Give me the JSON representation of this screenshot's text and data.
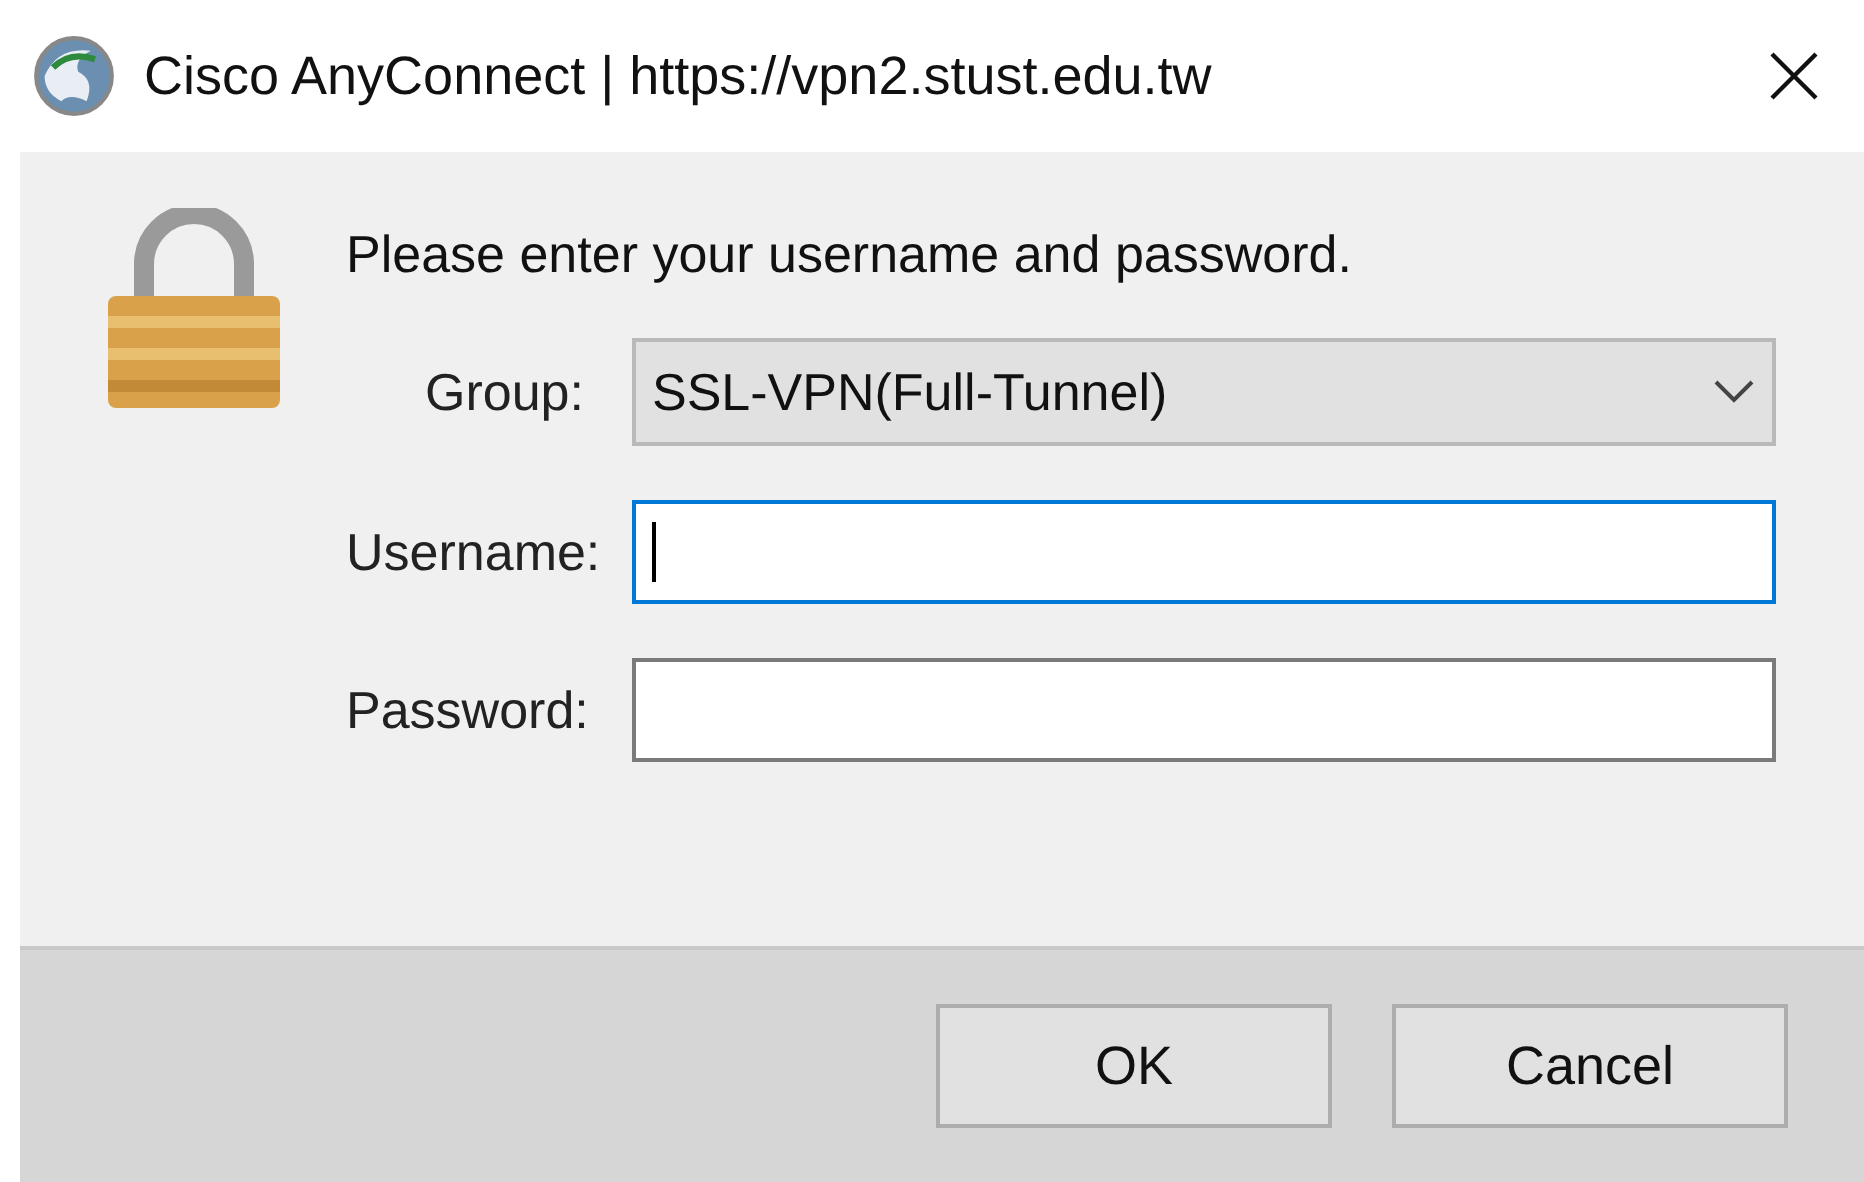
{
  "window": {
    "title": "Cisco AnyConnect | https://vpn2.stust.edu.tw"
  },
  "message": "Please enter your username and password.",
  "fields": [
    {
      "kind": "dropdown",
      "label": "Group:",
      "value": "SSL-VPN(Full-Tunnel)",
      "focused": false
    },
    {
      "kind": "text",
      "label": "Username:",
      "focused": true
    },
    {
      "kind": "text",
      "label": "Password:",
      "focused": false
    }
  ],
  "buttons": [
    "OK",
    "Cancel"
  ]
}
